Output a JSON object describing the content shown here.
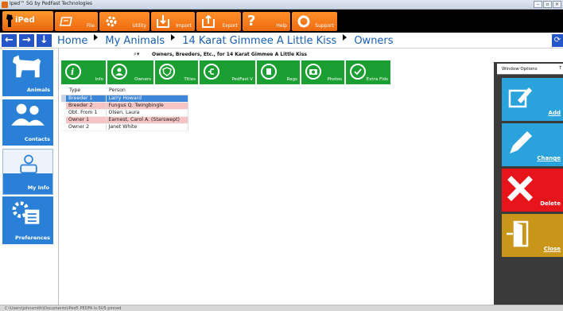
{
  "window": {
    "title": "Iped™ 5G by PedFast Technologies"
  },
  "brand": {
    "label": "iPed"
  },
  "toolbar": [
    {
      "name": "file",
      "label": "File"
    },
    {
      "name": "utility",
      "label": "Utility"
    },
    {
      "name": "import",
      "label": "Import"
    },
    {
      "name": "export",
      "label": "Export"
    },
    {
      "name": "help",
      "label": "Help"
    },
    {
      "name": "support",
      "label": "Support"
    }
  ],
  "breadcrumbs": [
    "Home",
    "My Animals",
    "14 Karat Gimmee A Little Kiss",
    "Owners"
  ],
  "leftnav": [
    {
      "name": "animals",
      "label": "Animals"
    },
    {
      "name": "contacts",
      "label": "Contacts"
    },
    {
      "name": "my-info",
      "label": "My Info"
    },
    {
      "name": "preferences",
      "label": "Preferences"
    }
  ],
  "grid": {
    "title": "Owners, Breeders, Etc., for 14 Karat Gimmee A Little Kiss",
    "columns": [
      "Type",
      "Person"
    ],
    "rows": [
      {
        "type": "Breeder 1",
        "person": "Larry Howard",
        "state": "selected"
      },
      {
        "type": "Breeder 2",
        "person": "Fungus Q. Twingbingle",
        "state": "pink"
      },
      {
        "type": "Obt. From 1",
        "person": "Olsen, Laura",
        "state": "white"
      },
      {
        "type": "Owner 1",
        "person": "Earnest, Carol A. (Starswept)",
        "state": "pink"
      },
      {
        "type": "Owner 2",
        "person": "Janet White",
        "state": "white"
      }
    ]
  },
  "actions": [
    {
      "name": "info",
      "label": "Info"
    },
    {
      "name": "owners",
      "label": "Owners"
    },
    {
      "name": "titles",
      "label": "Titles"
    },
    {
      "name": "pedfast-v",
      "label": "PedFast V"
    },
    {
      "name": "regs",
      "label": "Regs"
    },
    {
      "name": "photos",
      "label": "Photos"
    },
    {
      "name": "extra-flds",
      "label": "Extra Flds"
    }
  ],
  "options": {
    "title": "Window Options",
    "pin": "↑",
    "add": "Add",
    "change": "Change",
    "delete": "Delete",
    "close": "Close"
  },
  "colors": {
    "toolbar_orange": "#ef6b10",
    "nav_blue": "#2a7fd6",
    "action_green": "#1b9e32",
    "opt_blue": "#2aa3dd",
    "opt_red": "#e8141c",
    "opt_gold": "#c9961a",
    "row_pink": "#f6c4c4",
    "row_selected": "#3b86d8"
  },
  "status": {
    "path": "C:\\Users\\johnsmith\\Documents\\iPed5 PEDFA ls-5U5 pinned"
  }
}
